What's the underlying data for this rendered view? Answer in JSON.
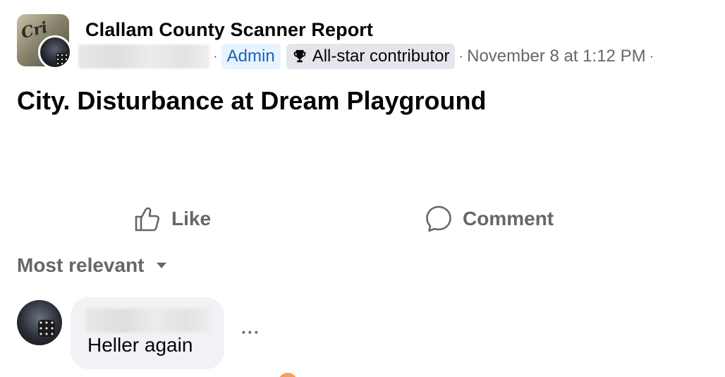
{
  "post": {
    "group_name": "Clallam County Scanner Report",
    "separator": "·",
    "admin_badge": "Admin",
    "allstar_badge": "All-star contributor",
    "timestamp": "November 8 at 1:12 PM",
    "text": "City. Disturbance at Dream Playground",
    "trophy_icon": "trophy-icon",
    "group_avatar_text": "Cri"
  },
  "actions": {
    "like_label": "Like",
    "comment_label": "Comment",
    "like_icon": "thumbs-up-icon",
    "comment_icon": "speech-bubble-icon"
  },
  "comments": {
    "sort_label": "Most relevant",
    "items": [
      {
        "text": "Heller again",
        "more_label": "···"
      }
    ]
  },
  "colors": {
    "admin_badge_bg": "#e7f3ff",
    "admin_badge_text": "#1c62b9",
    "secondary_text": "#65676b",
    "bubble_bg": "#f0f2f5"
  }
}
